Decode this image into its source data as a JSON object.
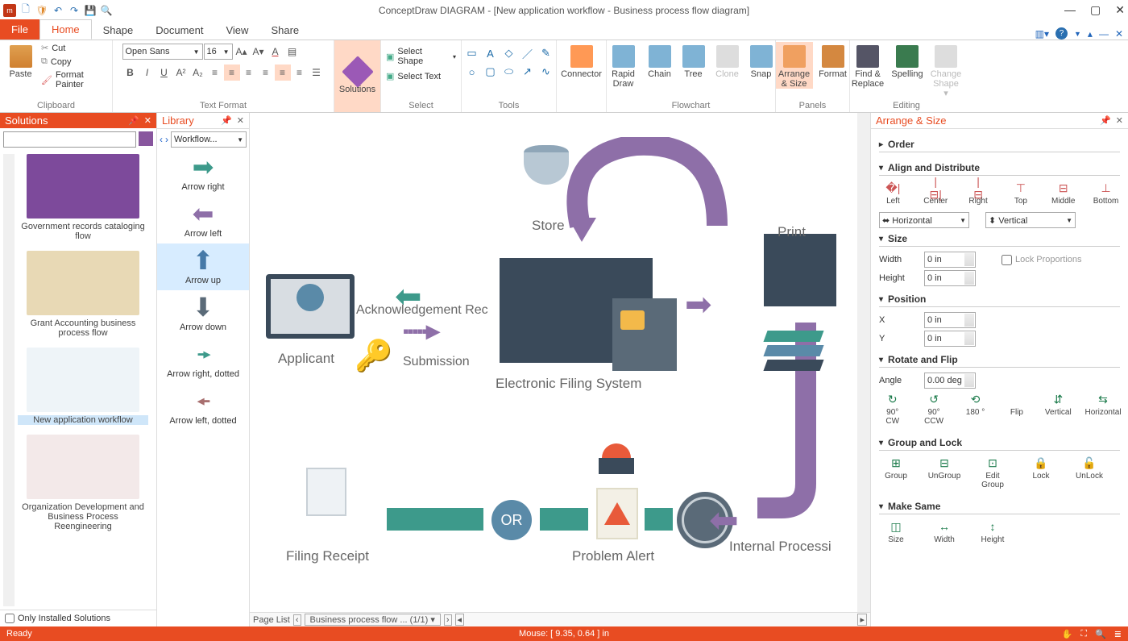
{
  "title": "ConceptDraw DIAGRAM - [New application workflow - Business process flow diagram]",
  "tabs": {
    "file": "File",
    "home": "Home",
    "shape": "Shape",
    "document": "Document",
    "view": "View",
    "share": "Share"
  },
  "ribbon": {
    "clipboard": {
      "paste": "Paste",
      "cut": "Cut",
      "copy": "Copy",
      "formatpainter": "Format Painter",
      "label": "Clipboard"
    },
    "textformat": {
      "font": "Open Sans",
      "size": "16",
      "label": "Text Format"
    },
    "solutions": {
      "btn": "Solutions"
    },
    "select": {
      "selectshape": "Select Shape",
      "selecttext": "Select Text",
      "label": "Select"
    },
    "tools": {
      "label": "Tools"
    },
    "connector": "Connector",
    "flowchart": {
      "rapid": "Rapid Draw",
      "chain": "Chain",
      "tree": "Tree",
      "clone": "Clone",
      "snap": "Snap",
      "arrange": "Arrange & Size",
      "format": "Format",
      "label_fc": "Flowchart",
      "label_panels": "Panels"
    },
    "editing": {
      "find": "Find & Replace",
      "spelling": "Spelling",
      "change": "Change Shape",
      "label": "Editing"
    }
  },
  "solutionsPanel": {
    "title": "Solutions",
    "items": [
      {
        "cap": "Government records cataloging flow"
      },
      {
        "cap": "Grant Accounting business process flow"
      },
      {
        "cap": "New application workflow"
      },
      {
        "cap": "Organization Development and Business Process Reengineering"
      }
    ],
    "foot": "Only Installed Solutions"
  },
  "libraryPanel": {
    "title": "Library",
    "selector": "Workflow...",
    "items": [
      {
        "label": "Arrow right"
      },
      {
        "label": "Arrow left"
      },
      {
        "label": "Arrow up"
      },
      {
        "label": "Arrow down"
      },
      {
        "label": "Arrow right, dotted"
      },
      {
        "label": "Arrow left, dotted"
      }
    ]
  },
  "diagram": {
    "store": "Store",
    "print": "Print",
    "applicant": "Applicant",
    "ack": "Acknowledgement Rec",
    "submission": "Submission",
    "efs": "Electronic Filing System",
    "filing": "Filing Receipt",
    "or": "OR",
    "problem": "Problem Alert",
    "internal": "Internal Processi"
  },
  "arrsize": {
    "title": "Arrange & Size",
    "order": "Order",
    "align": {
      "title": "Align and Distribute",
      "left": "Left",
      "center": "Center",
      "right": "Right",
      "top": "Top",
      "middle": "Middle",
      "bottom": "Bottom",
      "horiz": "Horizontal",
      "vert": "Vertical"
    },
    "size": {
      "title": "Size",
      "width": "Width",
      "height": "Height",
      "wv": "0 in",
      "hv": "0 in",
      "lock": "Lock Proportions"
    },
    "position": {
      "title": "Position",
      "x": "X",
      "y": "Y",
      "xv": "0 in",
      "yv": "0 in"
    },
    "rotate": {
      "title": "Rotate and Flip",
      "angle": "Angle",
      "av": "0.00 deg",
      "cw": "90° CW",
      "ccw": "90° CCW",
      "d180": "180 °",
      "flip": "Flip",
      "vert": "Vertical",
      "horiz": "Horizontal"
    },
    "group": {
      "title": "Group and Lock",
      "group": "Group",
      "ungroup": "UnGroup",
      "edit": "Edit Group",
      "lock": "Lock",
      "unlock": "UnLock"
    },
    "same": {
      "title": "Make Same",
      "size": "Size",
      "width": "Width",
      "height": "Height"
    }
  },
  "pagebar": {
    "label": "Page List",
    "page": "Business process flow ...  (1/1)"
  },
  "status": {
    "ready": "Ready",
    "mouse": "Mouse: [ 9.35, 0.64 ] in"
  }
}
